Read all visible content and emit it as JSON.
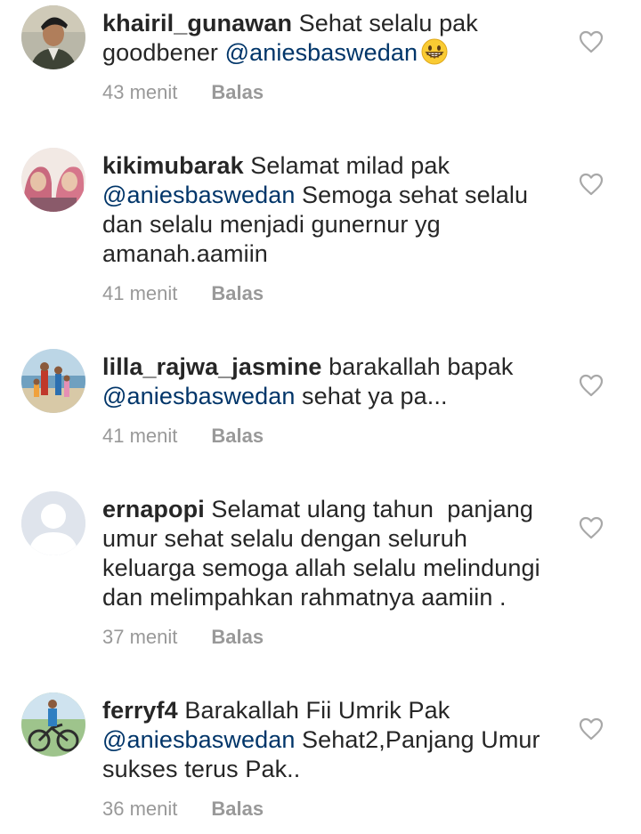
{
  "comments": [
    {
      "username": "khairil_gunawan",
      "text_before": " Sehat selalu pak goodbener ",
      "mention": "@aniesbaswedan",
      "text_after": "",
      "emoji": "grinning-face-emoji",
      "time": "43 menit",
      "reply": "Balas",
      "avatar": "avatar-photo-man-in-uniform"
    },
    {
      "username": "kikimubarak",
      "text_before": " Selamat milad pak ",
      "mention": "@aniesbaswedan",
      "text_after": " Semoga sehat selalu dan selalu menjadi gunernur yg amanah.aamiin",
      "time": "41 menit",
      "reply": "Balas",
      "avatar": "avatar-photo-two-women-hijab"
    },
    {
      "username": "lilla_rajwa_jasmine",
      "text_before": " barakallah bapak ",
      "mention": "@aniesbaswedan",
      "text_after": " sehat ya pa...",
      "time": "41 menit",
      "reply": "Balas",
      "avatar": "avatar-photo-family-at-beach"
    },
    {
      "username": "ernapopi",
      "text_before": " Selamat ulang tahun  panjang umur sehat selalu dengan seluruh keluarga semoga allah selalu melindungi dan melimpahkan rahmatnya aamiin .",
      "mention": "",
      "text_after": "",
      "time": "37 menit",
      "reply": "Balas",
      "avatar": "default-user-avatar"
    },
    {
      "username": "ferryf4",
      "text_before": " Barakallah Fii Umrik Pak ",
      "mention": "@aniesbaswedan",
      "text_after": " Sehat2,Panjang Umur sukses terus Pak..",
      "time": "36 menit",
      "reply": "Balas",
      "avatar": "avatar-photo-cyclist"
    }
  ],
  "colors": {
    "text": "#262626",
    "mention": "#003569",
    "meta": "#999999",
    "heart": "#a8a8a8"
  }
}
